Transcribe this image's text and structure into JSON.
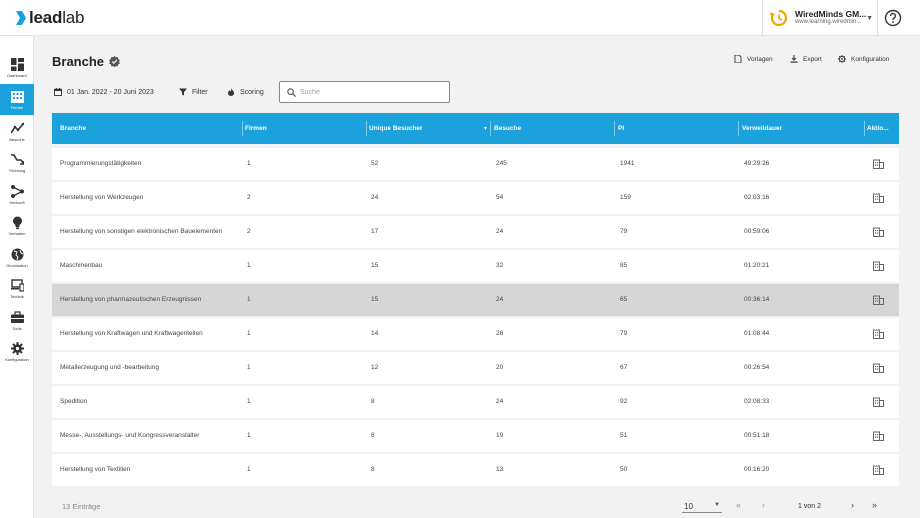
{
  "app": {
    "logo_lead": "lead",
    "logo_lab": "lab",
    "account_name": "WiredMinds GM...",
    "account_url": "www.learning.wiredmin...",
    "colors": {
      "accent": "#1ba1dc",
      "account_icon": "#f0a500"
    }
  },
  "sidebar": {
    "items": [
      {
        "label": "Dashboard",
        "icon": "dashboard-icon"
      },
      {
        "label": "Firmen",
        "icon": "building-icon"
      },
      {
        "label": "Besuche",
        "icon": "visits-chart-icon"
      },
      {
        "label": "Trichtung",
        "icon": "funnel-icon"
      },
      {
        "label": "Herkunft",
        "icon": "source-network-icon"
      },
      {
        "label": "Verhalten",
        "icon": "lightbulb-icon"
      },
      {
        "label": "Geolokation",
        "icon": "globe-icon"
      },
      {
        "label": "Technik",
        "icon": "devices-icon"
      },
      {
        "label": "Tools",
        "icon": "toolbox-icon"
      },
      {
        "label": "Konfiguration",
        "icon": "gear-icon"
      }
    ],
    "active_index": 1
  },
  "page": {
    "title": "Branche",
    "actions": {
      "vorlagen": "Vorlagen",
      "export": "Export",
      "konfiguration": "Konfiguration"
    },
    "toolbar": {
      "date_range": "01 Jan. 2022 - 20 Juni 2023",
      "filter": "Filter",
      "scoring": "Scoring"
    },
    "search": {
      "placeholder": "Suche",
      "value": ""
    }
  },
  "table": {
    "columns": [
      "Branche",
      "Firmen",
      "Unique Besucher",
      "Besuche",
      "PI",
      "Verweildauer",
      "Aktio..."
    ],
    "sorted_column": "Unique Besucher",
    "sort_direction": "desc",
    "hover_row_index": 4,
    "rows": [
      {
        "branche": "Programmierungstätigkeiten",
        "firmen": "1",
        "unique": "52",
        "besuche": "245",
        "pi": "1941",
        "dauer": "49:29:26"
      },
      {
        "branche": "Herstellung von Werkzeugen",
        "firmen": "2",
        "unique": "24",
        "besuche": "54",
        "pi": "159",
        "dauer": "02:03:16"
      },
      {
        "branche": "Herstellung von sonstigen elektronischen Bauelementen",
        "firmen": "2",
        "unique": "17",
        "besuche": "24",
        "pi": "79",
        "dauer": "00:59:06"
      },
      {
        "branche": "Maschinenbau",
        "firmen": "1",
        "unique": "15",
        "besuche": "32",
        "pi": "85",
        "dauer": "01:20:21"
      },
      {
        "branche": "Herstellung von pharmazeutischen Erzeugnissen",
        "firmen": "1",
        "unique": "15",
        "besuche": "24",
        "pi": "65",
        "dauer": "00:36:14"
      },
      {
        "branche": "Herstellung von Kraftwagen und Kraftwagenteilen",
        "firmen": "1",
        "unique": "14",
        "besuche": "28",
        "pi": "79",
        "dauer": "01:08:44"
      },
      {
        "branche": "Metallerzeugung und -bearbeitung",
        "firmen": "1",
        "unique": "12",
        "besuche": "20",
        "pi": "67",
        "dauer": "00:26:54"
      },
      {
        "branche": "Spedition",
        "firmen": "1",
        "unique": "8",
        "besuche": "24",
        "pi": "92",
        "dauer": "02:08:33"
      },
      {
        "branche": "Messe-, Ausstellungs- und Kongressveranstalter",
        "firmen": "1",
        "unique": "8",
        "besuche": "19",
        "pi": "51",
        "dauer": "00:51:18"
      },
      {
        "branche": "Herstellung von Textilien",
        "firmen": "1",
        "unique": "8",
        "besuche": "13",
        "pi": "50",
        "dauer": "00:16:20"
      }
    ]
  },
  "footer": {
    "count": "13 Einträge",
    "page_size": "10",
    "page_info": "1 von 2",
    "first": "«",
    "prev": "‹",
    "next": "›",
    "last": "»"
  }
}
